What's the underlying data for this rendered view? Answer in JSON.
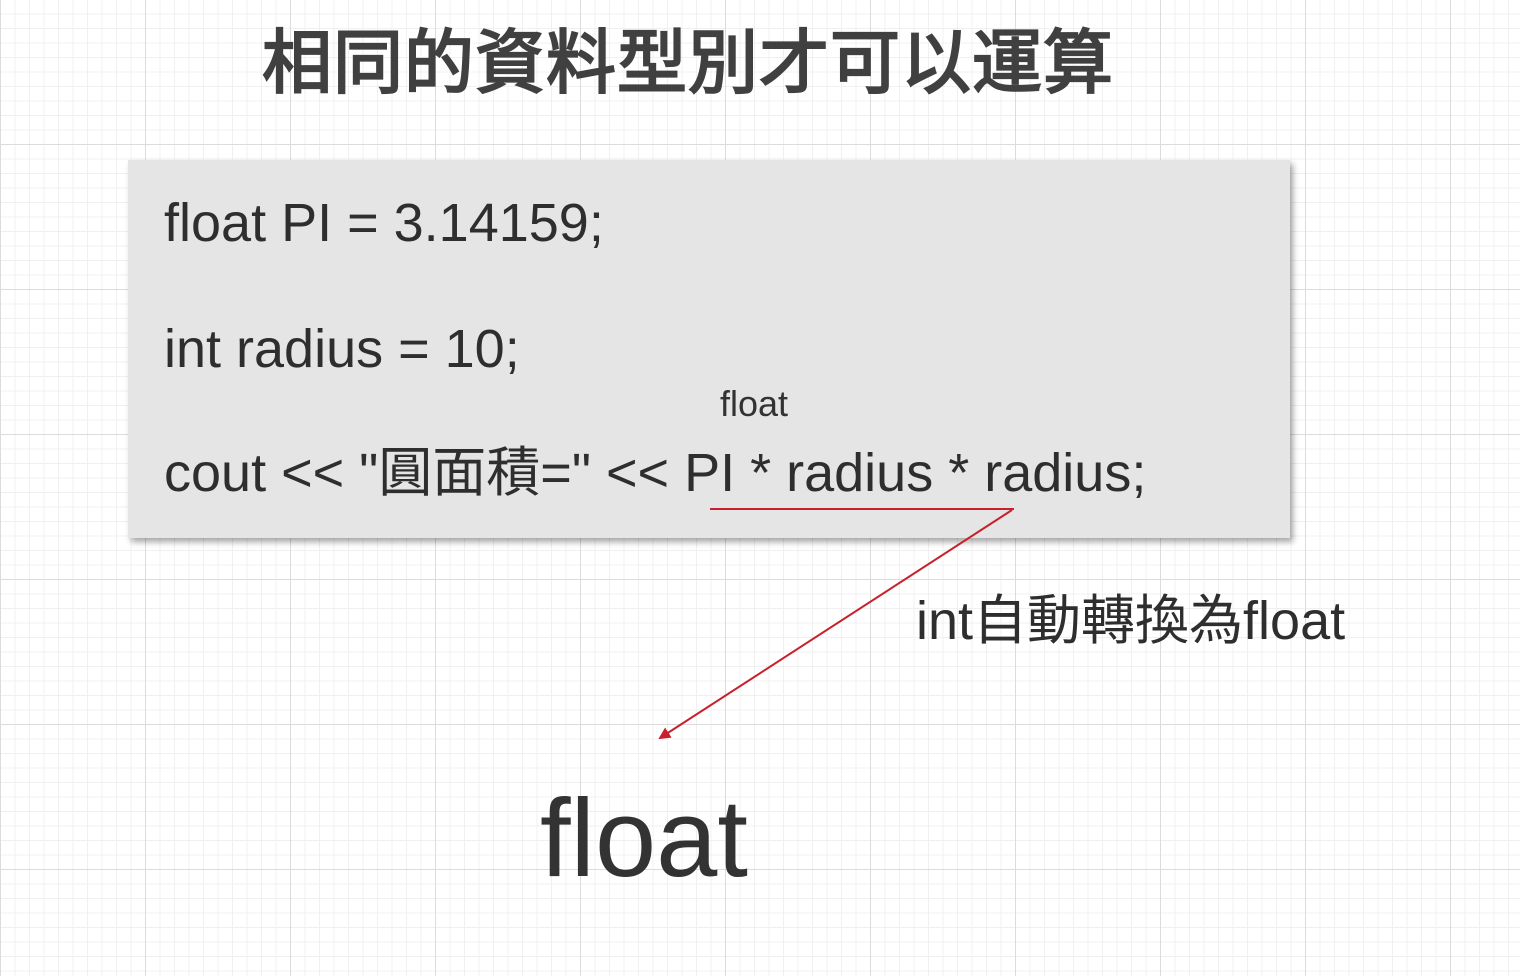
{
  "title": "相同的資料型別才可以運算",
  "code": {
    "line1": "float PI = 3.14159;",
    "line2": "int radius = 10;",
    "line3_prefix": "cout << \"圓面積=\" << ",
    "line3_expr": "PI * radius",
    "line3_suffix": " * radius;"
  },
  "annotation_above": "float",
  "conversion_note": "int自動轉換為float",
  "result_type": "float",
  "colors": {
    "arrow": "#c8202c",
    "code_bg": "#e5e5e5"
  }
}
